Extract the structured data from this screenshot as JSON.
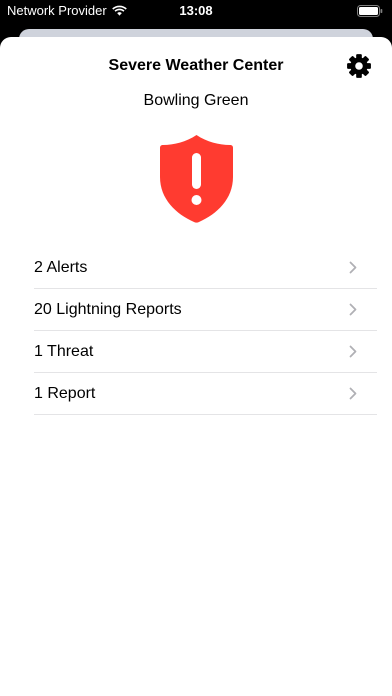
{
  "status_bar": {
    "carrier": "Network Provider",
    "time": "13:08"
  },
  "header": {
    "title": "Severe Weather Center",
    "settings_icon": "gear-icon"
  },
  "location": "Bowling Green",
  "alert_icon": {
    "name": "shield-alert-icon",
    "color": "#ff3b30"
  },
  "menu": {
    "items": [
      {
        "label": "2 Alerts"
      },
      {
        "label": "20 Lightning Reports"
      },
      {
        "label": "1 Threat"
      },
      {
        "label": "1 Report"
      }
    ]
  },
  "colors": {
    "alert": "#ff3b30",
    "separator": "#e4e4e6",
    "chevron": "#b0b0b5"
  }
}
